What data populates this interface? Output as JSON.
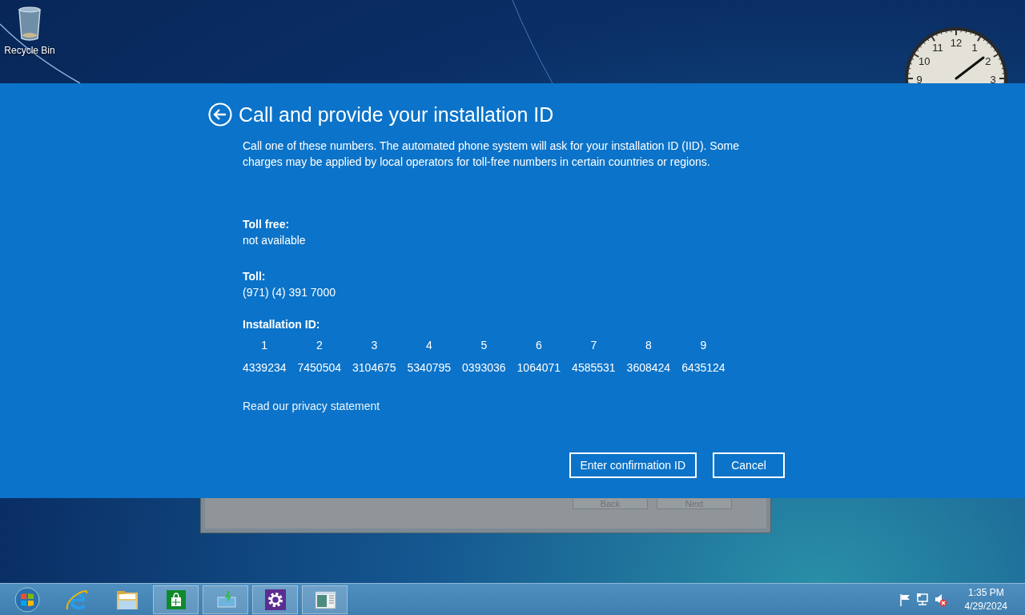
{
  "desktop": {
    "icons": [
      {
        "label": "Recycle Bin"
      }
    ],
    "clock": {
      "numerals": [
        "11",
        "12",
        "1",
        "10",
        "2",
        "9",
        "3"
      ]
    },
    "background_window": {
      "buttons": [
        {
          "label": "Back"
        },
        {
          "label": "Next"
        }
      ]
    }
  },
  "dialog": {
    "title": "Call and provide your installation ID",
    "description": "Call one of these numbers. The automated phone system will ask for your installation ID (IID). Some charges may be applied by local operators for toll-free numbers in certain countries or regions.",
    "toll_free": {
      "label": "Toll free:",
      "value": "not available"
    },
    "toll": {
      "label": "Toll:",
      "value": "(971) (4) 391 7000"
    },
    "installation_id": {
      "label": "Installation ID:",
      "groups": [
        {
          "number": "1",
          "value": "4339234"
        },
        {
          "number": "2",
          "value": "7450504"
        },
        {
          "number": "3",
          "value": "3104675"
        },
        {
          "number": "4",
          "value": "5340795"
        },
        {
          "number": "5",
          "value": "0393036"
        },
        {
          "number": "6",
          "value": "1064071"
        },
        {
          "number": "7",
          "value": "4585531"
        },
        {
          "number": "8",
          "value": "3608424"
        },
        {
          "number": "9",
          "value": "6435124"
        }
      ]
    },
    "privacy_link": "Read our privacy statement",
    "buttons": [
      {
        "label": "Enter confirmation ID"
      },
      {
        "label": "Cancel"
      }
    ]
  },
  "taskbar": {
    "apps": [
      {
        "kind": "start",
        "running": false
      },
      {
        "kind": "browser",
        "running": false
      },
      {
        "kind": "folder",
        "running": false
      },
      {
        "kind": "store",
        "running": true
      },
      {
        "kind": "download",
        "running": true
      },
      {
        "kind": "settings",
        "running": true
      },
      {
        "kind": "window",
        "running": true
      }
    ],
    "tray": {
      "volume_muted": true
    },
    "time": "1:35 PM",
    "date": "4/29/2024"
  }
}
